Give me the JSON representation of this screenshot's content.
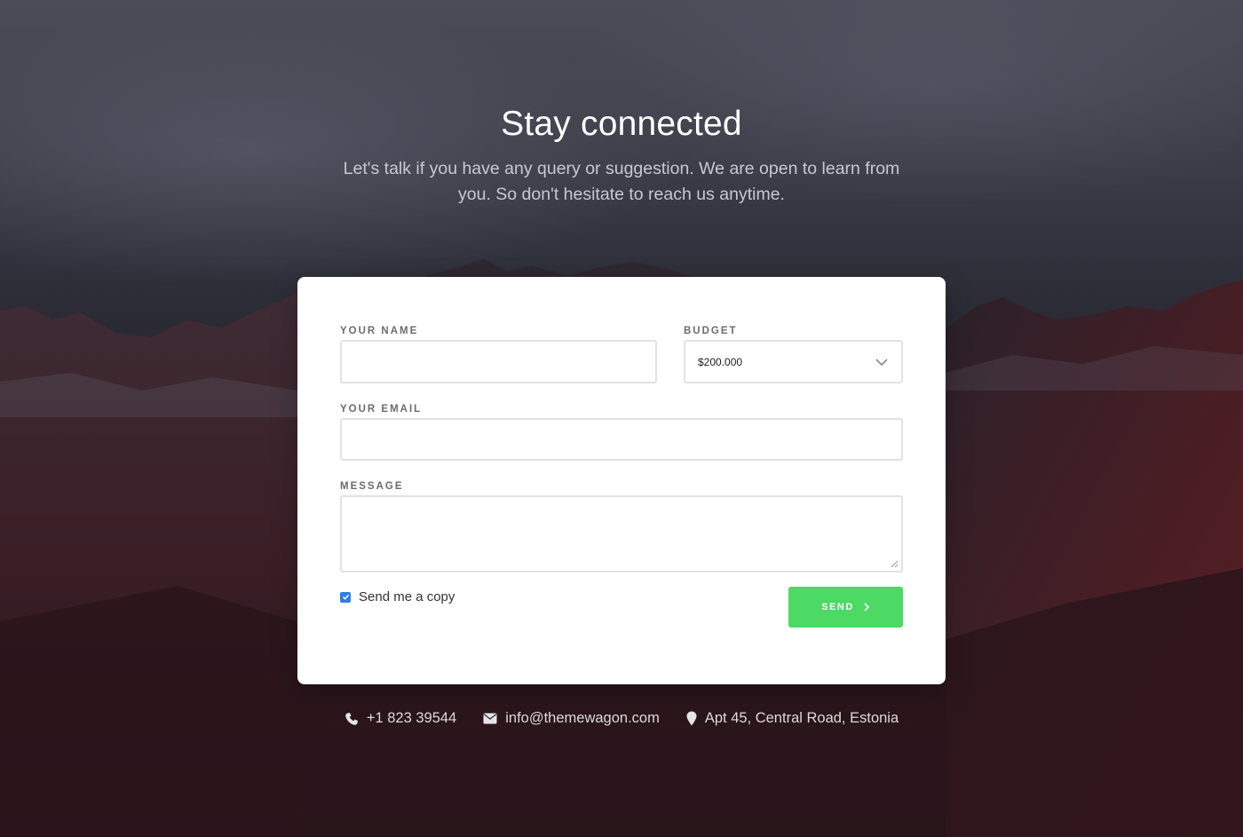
{
  "hero": {
    "title": "Stay connected",
    "subtitle": "Let's talk if you have any query or suggestion. We are open to learn from you. So don't hesitate to reach us anytime."
  },
  "form": {
    "name_label": "YOUR NAME",
    "name_value": "",
    "budget_label": "BUDGET",
    "budget_value": "$200.000",
    "email_label": "YOUR EMAIL",
    "email_value": "",
    "message_label": "MESSAGE",
    "message_value": "",
    "copy_label": "Send me a copy",
    "copy_checked": true,
    "send_label": "SEND"
  },
  "contacts": {
    "phone": "+1 823 39544",
    "email": "info@themewagon.com",
    "address": "Apt 45, Central Road, Estonia"
  },
  "icons": [
    "phone-icon",
    "envelope-icon",
    "map-marker-icon",
    "chevron-down-icon",
    "chevron-right-icon",
    "checkmark-icon"
  ],
  "colors": {
    "accent_green": "#4cd964",
    "checkbox_blue": "#2f7ee6",
    "card_bg": "#ffffff"
  }
}
